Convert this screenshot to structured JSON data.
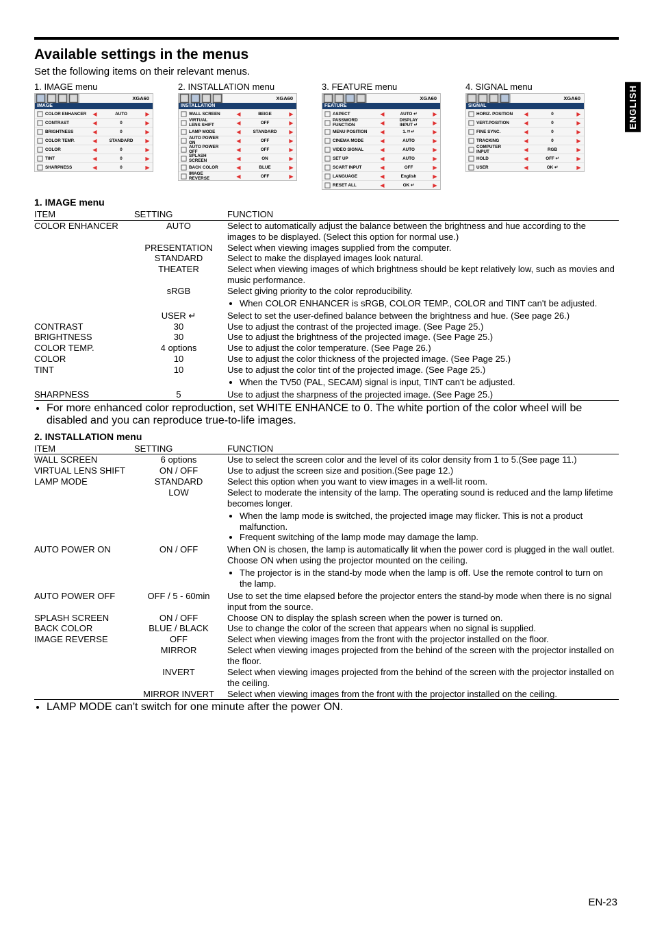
{
  "sideTab": "ENGLISH",
  "title": "Available settings in the menus",
  "subtitle": "Set the following items on their relevant menus.",
  "model": "XGA60",
  "thumbs": [
    {
      "title": "1. IMAGE menu",
      "band": "IMAGE",
      "rows": [
        {
          "name": "COLOR ENHANCER",
          "val": "AUTO"
        },
        {
          "name": "CONTRAST",
          "val": "0"
        },
        {
          "name": "BRIGHTNESS",
          "val": "0"
        },
        {
          "name": "COLOR TEMP.",
          "val": "STANDARD"
        },
        {
          "name": "COLOR",
          "val": "0"
        },
        {
          "name": "TINT",
          "val": "0"
        },
        {
          "name": "SHARPNESS",
          "val": "0"
        }
      ]
    },
    {
      "title": "2. INSTALLATION menu",
      "band": "INSTALLATION",
      "rows": [
        {
          "name": "WALL SCREEN",
          "val": "BEIGE"
        },
        {
          "name": "VIRTUAL\nLENS SHIFT",
          "val": "OFF"
        },
        {
          "name": "LAMP MODE",
          "val": "STANDARD"
        },
        {
          "name": "AUTO POWER\nON",
          "val": "OFF"
        },
        {
          "name": "AUTO POWER\nOFF",
          "val": "OFF"
        },
        {
          "name": "SPLASH\nSCREEN",
          "val": "ON"
        },
        {
          "name": "BACK COLOR",
          "val": "BLUE"
        },
        {
          "name": "IMAGE\nREVERSE",
          "val": "OFF"
        }
      ]
    },
    {
      "title": "3. FEATURE menu",
      "band": "FEATURE",
      "rows": [
        {
          "name": "ASPECT",
          "val": "AUTO ↵"
        },
        {
          "name": "PASSWORD\nFUNCTION",
          "val": "DISPLAY\nINPUT  ↵"
        },
        {
          "name": "MENU POSITION",
          "val": "1. ⌑ ↵"
        },
        {
          "name": "CINEMA MODE",
          "val": "AUTO"
        },
        {
          "name": "VIDEO SIGNAL",
          "val": "AUTO"
        },
        {
          "name": "SET UP",
          "val": "AUTO"
        },
        {
          "name": "SCART INPUT",
          "val": "OFF"
        },
        {
          "name": "LANGUAGE",
          "val": "English"
        },
        {
          "name": "RESET ALL",
          "val": "OK ↵"
        }
      ]
    },
    {
      "title": "4. SIGNAL menu",
      "band": "SIGNAL",
      "rows": [
        {
          "name": "HORIZ. POSITION",
          "val": "0"
        },
        {
          "name": "VERT.POSITION",
          "val": "0"
        },
        {
          "name": "FINE SYNC.",
          "val": "0"
        },
        {
          "name": "TRACKING",
          "val": "0"
        },
        {
          "name": "COMPUTER\nINPUT",
          "val": "RGB"
        },
        {
          "name": "HOLD",
          "val": "OFF ↵"
        },
        {
          "name": "USER",
          "val": "OK ↵"
        }
      ]
    }
  ],
  "sec1": {
    "title": "1. IMAGE menu",
    "hdr": {
      "item": "ITEM",
      "setting": "SETTING",
      "fn": "FUNCTION"
    },
    "rows": [
      {
        "item": "COLOR ENHANCER",
        "setting": "AUTO",
        "fn": "Select to automatically adjust the balance between the brightness and hue according to the images to be displayed. (Select this option for normal use.)"
      },
      {
        "item": "",
        "setting": "PRESENTATION",
        "fn": "Select when viewing images supplied from the computer."
      },
      {
        "item": "",
        "setting": "STANDARD",
        "fn": "Select to make the displayed images look natural."
      },
      {
        "item": "",
        "setting": "THEATER",
        "fn": "Select when viewing images of which brightness should be kept relatively low, such as movies and music performance."
      },
      {
        "item": "",
        "setting": "sRGB",
        "fn": "Select giving priority to the color reproducibility.",
        "bullets": [
          "When COLOR ENHANCER is sRGB, COLOR TEMP., COLOR and TINT can't be adjusted."
        ]
      },
      {
        "item": "",
        "setting": "USER ↵",
        "fn": "Select to set the user-defined balance between the brightness and hue. (See page 26.)"
      },
      {
        "item": "CONTRAST",
        "setting": "30",
        "fn": "Use to adjust the contrast of the projected image. (See Page 25.)"
      },
      {
        "item": "BRIGHTNESS",
        "setting": "30",
        "fn": "Use to adjust the brightness of the projected image. (See Page 25.)"
      },
      {
        "item": "COLOR TEMP.",
        "setting": "4 options",
        "fn": "Use to adjust the color temperature. (See Page 26.)"
      },
      {
        "item": "COLOR",
        "setting": "10",
        "fn": "Use to adjust the color thickness of the projected image. (See Page 25.)"
      },
      {
        "item": "TINT",
        "setting": "10",
        "fn": "Use to adjust the color tint of the projected image. (See Page 25.)",
        "bullets": [
          "When the TV50 (PAL, SECAM) signal is input, TINT can't be adjusted."
        ]
      },
      {
        "item": "SHARPNESS",
        "setting": "5",
        "fn": "Use to adjust the sharpness of the projected image. (See Page 25.)"
      }
    ],
    "note": "For more enhanced color reproduction, set WHITE ENHANCE to 0. The white portion of the color wheel will be disabled and you can reproduce true-to-life images."
  },
  "sec2": {
    "title": "2. INSTALLATION menu",
    "hdr": {
      "item": "ITEM",
      "setting": "SETTING",
      "fn": "FUNCTION"
    },
    "rows": [
      {
        "item": "WALL SCREEN",
        "setting": "6 options",
        "fn": "Use to select the screen color and the level of its color density from 1 to 5.(See page 11.)"
      },
      {
        "item": "VIRTUAL LENS SHIFT",
        "setting": "ON / OFF",
        "fn": "Use to adjust the screen size and position.(See page 12.)"
      },
      {
        "item": "LAMP MODE",
        "setting": "STANDARD",
        "fn": "Select this option when you want to view images in a well-lit room."
      },
      {
        "item": "",
        "setting": "LOW",
        "fn": "Select to moderate the intensity of the lamp. The operating sound is reduced and the lamp lifetime becomes longer.",
        "bullets": [
          "When the lamp mode is switched, the projected image may flicker. This is not a product malfunction.",
          "Frequent switching of the lamp mode may damage the lamp."
        ]
      },
      {
        "item": "AUTO POWER ON",
        "setting": "ON / OFF",
        "fn": "When ON is chosen, the lamp is automatically lit when the power cord is plugged in the wall outlet. Choose ON when using the projector mounted on the ceiling.",
        "bullets": [
          "The projector is in the stand-by mode when the lamp is off.  Use the remote control to turn on the lamp."
        ]
      },
      {
        "item": "AUTO POWER OFF",
        "setting": "OFF / 5 - 60min",
        "fn": "Use to set the time elapsed before the projector enters the stand-by mode when there is no signal input from the source."
      },
      {
        "item": "SPLASH SCREEN",
        "setting": "ON / OFF",
        "fn": "Choose ON to display the splash screen when the power is turned on."
      },
      {
        "item": "BACK COLOR",
        "setting": "BLUE / BLACK",
        "fn": "Use to change the color of the screen that appears when no signal is supplied."
      },
      {
        "item": "IMAGE REVERSE",
        "setting": "OFF",
        "fn": "Select when viewing images from the front with the projector installed on the floor."
      },
      {
        "item": "",
        "setting": "MIRROR",
        "fn": "Select when viewing images projected from the behind of the screen with the projector installed on the floor."
      },
      {
        "item": "",
        "setting": "INVERT",
        "fn": "Select when viewing images projected from the behind of the screen with the projector installed on the ceiling."
      },
      {
        "item": "",
        "setting": "MIRROR INVERT",
        "fn": "Select when viewing images from the front with the projector installed on the ceiling."
      }
    ],
    "note": "LAMP MODE can't switch for one minute after the power ON."
  },
  "pageNum": "EN-23"
}
